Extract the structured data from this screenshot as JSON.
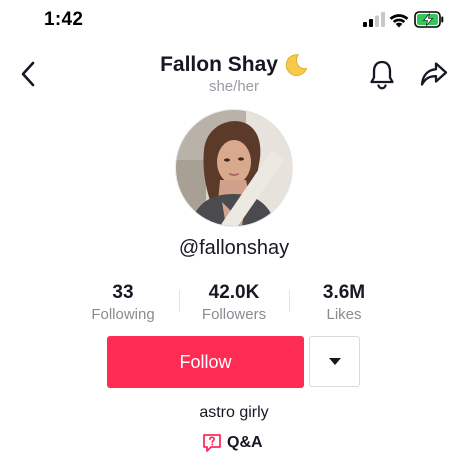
{
  "status_bar": {
    "time": "1:42",
    "icons": [
      "cellular-signal-icon",
      "wifi-icon",
      "battery-charging-icon"
    ]
  },
  "header": {
    "back_icon": "chevron-left-icon",
    "name": "Fallon Shay",
    "name_emoji_icon": "crescent-moon-icon",
    "pronouns": "she/her",
    "bell_icon": "bell-icon",
    "share_icon": "share-arrow-icon"
  },
  "profile": {
    "avatar_icon": "profile-photo",
    "username": "@fallonshay"
  },
  "stats": [
    {
      "value": "33",
      "label": "Following"
    },
    {
      "value": "42.0K",
      "label": "Followers"
    },
    {
      "value": "3.6M",
      "label": "Likes"
    }
  ],
  "actions": {
    "follow_label": "Follow",
    "more_icon": "caret-down-icon"
  },
  "bio": {
    "text": "astro girly",
    "qa_label": "Q&A",
    "qa_icon": "question-bubble-icon"
  },
  "colors": {
    "accent": "#fe2c55",
    "text_primary": "#161823",
    "text_secondary": "#8a8b91",
    "battery_green": "#34c759"
  }
}
